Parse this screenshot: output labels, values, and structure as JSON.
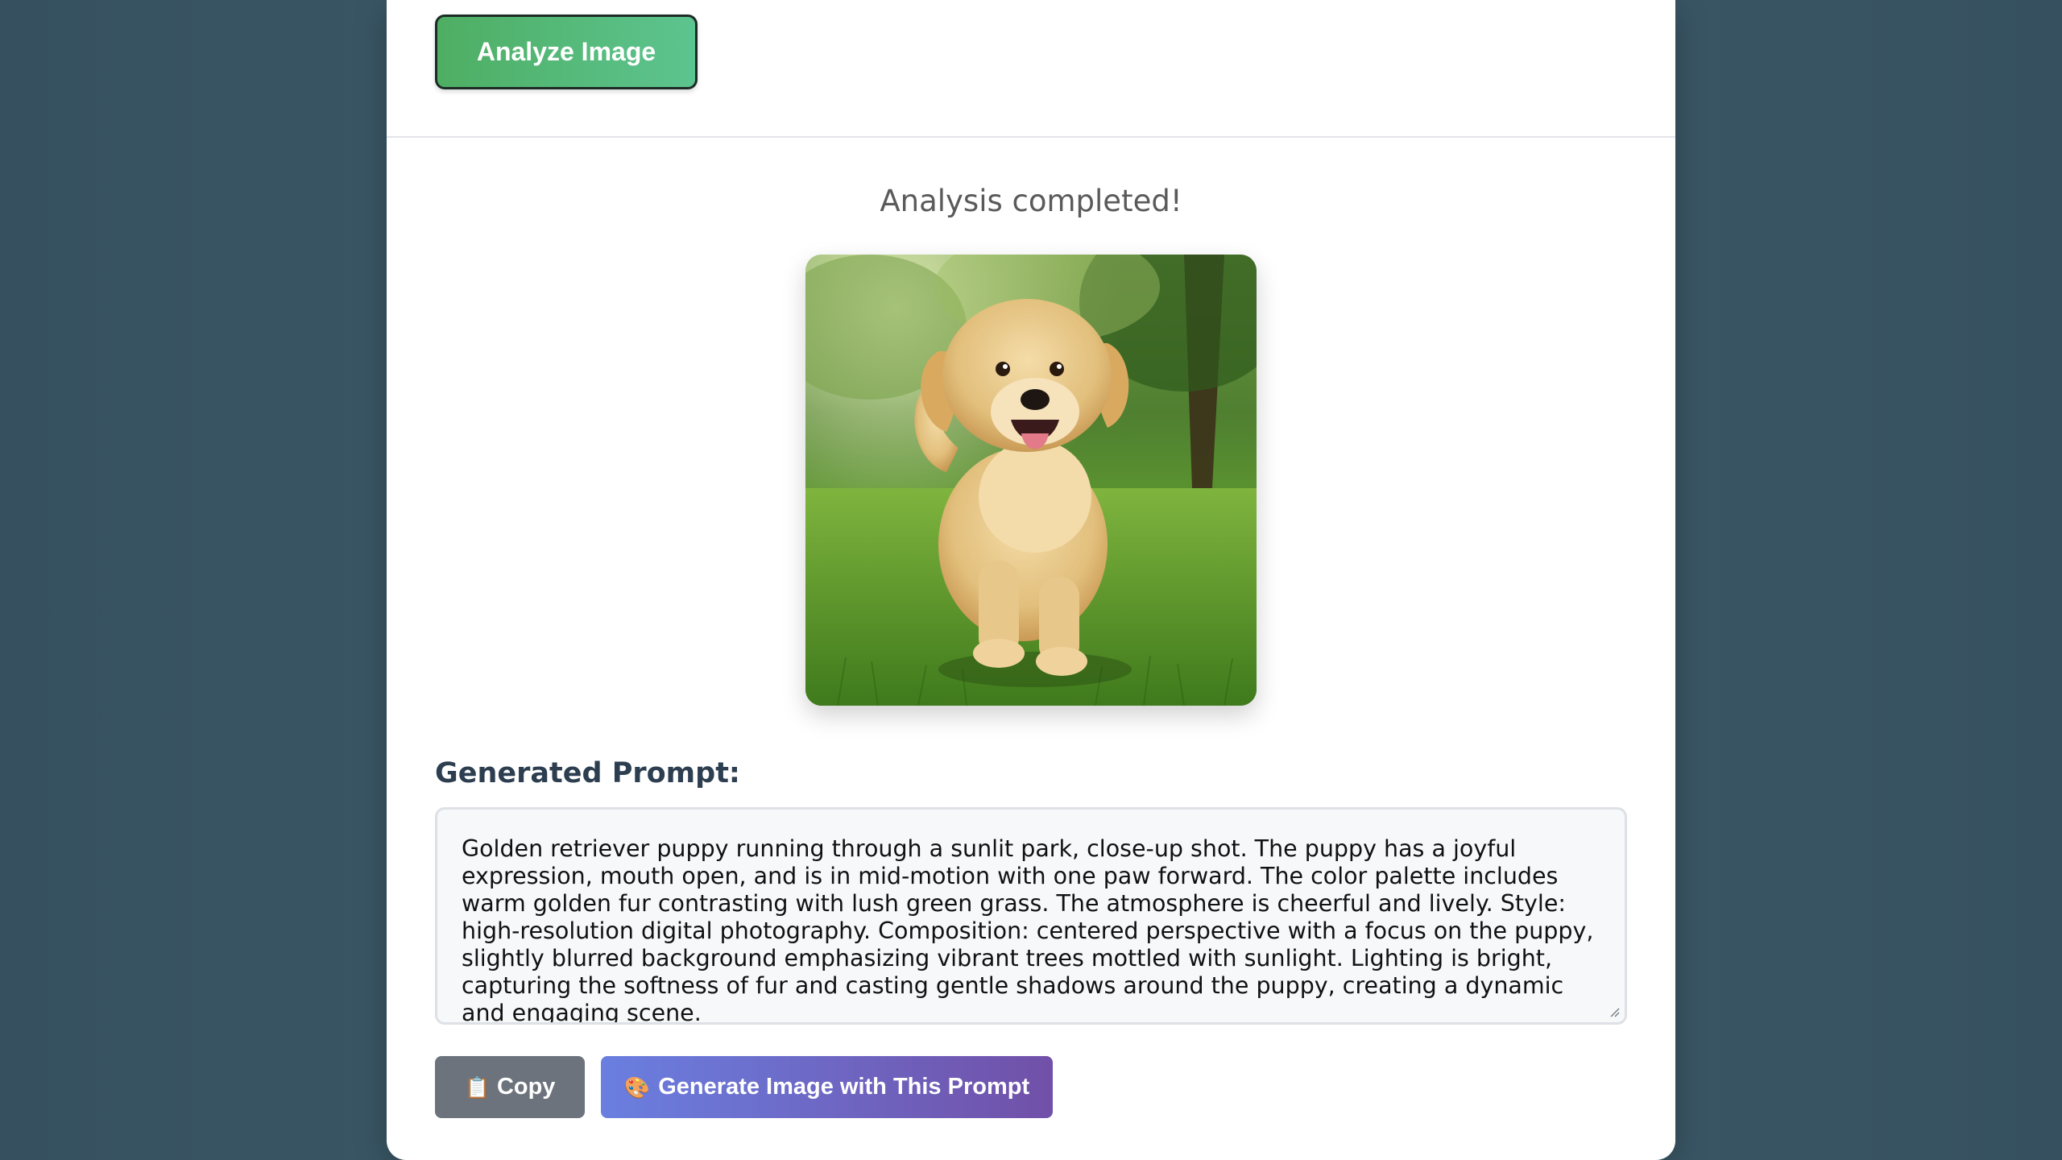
{
  "actions": {
    "analyze_label": "Analyze Image"
  },
  "result": {
    "status": "Analysis completed!",
    "image_subject": "golden retriever puppy running on grass in a sunlit park",
    "prompt_heading": "Generated Prompt:",
    "prompt_text": "Golden retriever puppy running through a sunlit park, close-up shot. The puppy has a joyful expression, mouth open, and is in mid-motion with one paw forward. The color palette includes warm golden fur contrasting with lush green grass. The atmosphere is cheerful and lively. Style: high-resolution digital photography. Composition: centered perspective with a focus on the puppy, slightly blurred background emphasizing vibrant trees mottled with sunlight. Lighting is bright, capturing the softness of fur and casting gentle shadows around the puppy, creating a dynamic and engaging scene."
  },
  "buttons": {
    "copy_icon": "clipboard-icon",
    "copy_label": "Copy",
    "generate_icon": "palette-icon",
    "generate_label": "Generate Image with This Prompt"
  },
  "colors": {
    "analyze_gradient": [
      "#4eae63",
      "#5cc48f"
    ],
    "copy_bg": "#6c737d",
    "generate_gradient": [
      "#6a7fe0",
      "#7150a8"
    ],
    "heading": "#2c3e50"
  }
}
